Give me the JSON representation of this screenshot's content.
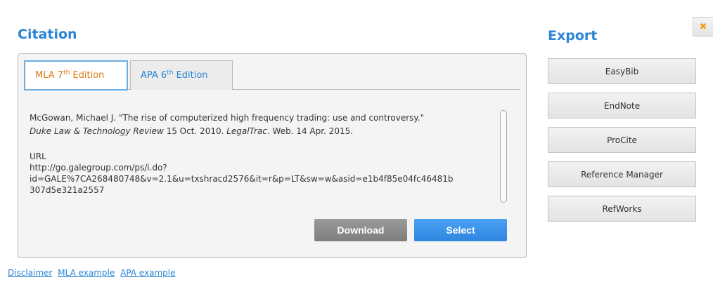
{
  "citation": {
    "title": "Citation",
    "tabs": [
      {
        "label": "MLA 7",
        "sup": "th",
        "suffix": " Edition",
        "active": true
      },
      {
        "label": "APA 6",
        "sup": "th",
        "suffix": " Edition",
        "active": false
      }
    ],
    "text": {
      "line1": "McGowan, Michael J. \"The rise of computerized high frequency trading: use and controversy.\"",
      "journal": "Duke Law & Technology Review",
      "date_part": " 15 Oct. 2010. ",
      "database": "LegalTrac",
      "end_part": ". Web. 14 Apr. 2015."
    },
    "url_label": "URL",
    "url_line1": "http://go.galegroup.com/ps/i.do?",
    "url_line2": "id=GALE%7CA268480748&v=2.1&u=txshracd2576&it=r&p=LT&sw=w&asid=e1b4f85e04fc46481b",
    "url_line3": "307d5e321a2557",
    "download_label": "Download",
    "select_label": "Select"
  },
  "footer": {
    "links": [
      "Disclaimer",
      "MLA example",
      "APA example"
    ]
  },
  "export": {
    "title": "Export",
    "buttons": [
      "EasyBib",
      "EndNote",
      "ProCite",
      "Reference Manager",
      "RefWorks"
    ]
  },
  "close": {
    "icon": "close-icon",
    "glyph": "✖",
    "color": "#f0a020"
  },
  "colors": {
    "accent": "#2a85d6",
    "active_tab": "#e07b1a"
  }
}
